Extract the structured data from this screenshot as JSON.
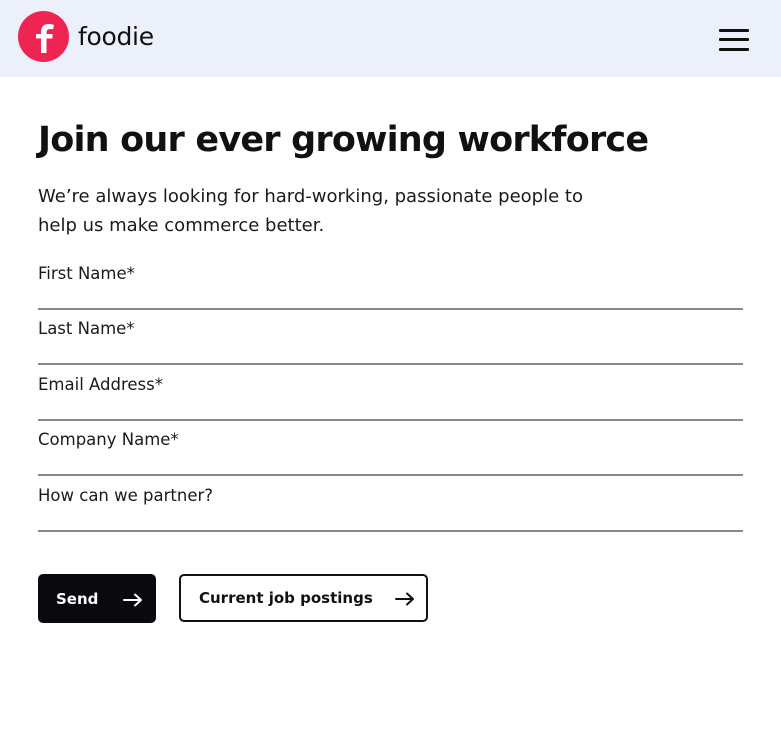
{
  "header": {
    "brand_name": "foodie",
    "logo_letter": "f",
    "logo_color": "#ee2452",
    "background_color": "#ebf0fa",
    "menu_icon": "hamburger-menu-icon"
  },
  "main": {
    "title": "Join our ever growing workforce",
    "intro": "We’re always looking for hard-working, passionate people to help us make commerce better."
  },
  "form": {
    "fields": [
      {
        "name": "first-name",
        "placeholder": "First Name*",
        "value": ""
      },
      {
        "name": "last-name",
        "placeholder": "Last Name*",
        "value": ""
      },
      {
        "name": "email-address",
        "placeholder": "Email Address*",
        "value": ""
      },
      {
        "name": "company-name",
        "placeholder": "Company Name*",
        "value": ""
      },
      {
        "name": "how-can-we-partner",
        "placeholder": "How can we partner?",
        "value": ""
      }
    ],
    "send_label": "Send",
    "jobs_label": "Current job postings",
    "arrow_icon": "arrow-right-icon",
    "primary_button_color": "#0a0a0e"
  }
}
